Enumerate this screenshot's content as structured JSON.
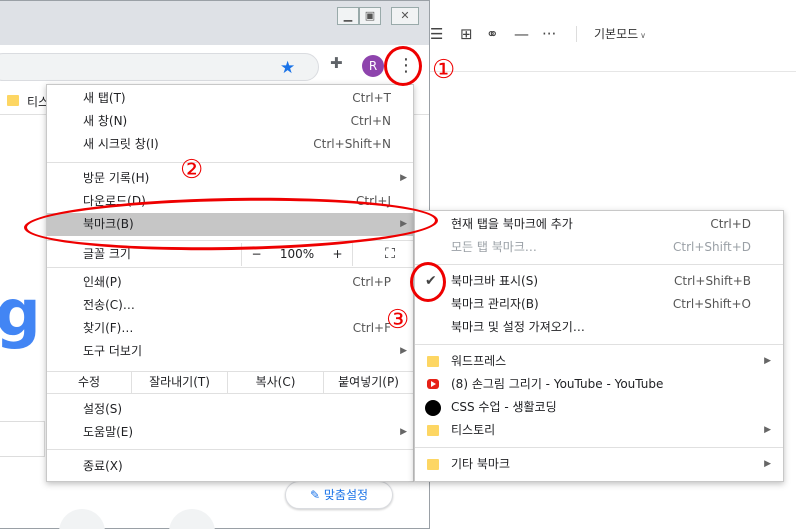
{
  "editor": {
    "mode_label": "기본모드",
    "icons": [
      "list-icon",
      "table-icon",
      "link-icon",
      "divider-icon",
      "more-icon"
    ]
  },
  "window": {
    "controls": [
      "minimize-icon",
      "restore-icon",
      "close-icon"
    ],
    "avatar_letter": "R",
    "bookmarks_bar": {
      "item": "티스"
    },
    "customize_button": "맞춤설정"
  },
  "menu": {
    "new_tab": {
      "label": "새 탭(T)",
      "shortcut": "Ctrl+T"
    },
    "new_window": {
      "label": "새 창(N)",
      "shortcut": "Ctrl+N"
    },
    "incognito": {
      "label": "새 시크릿 창(I)",
      "shortcut": "Ctrl+Shift+N"
    },
    "history": {
      "label": "방문 기록(H)"
    },
    "downloads": {
      "label": "다운로드(D)",
      "shortcut": "Ctrl+J"
    },
    "bookmarks": {
      "label": "북마크(B)"
    },
    "zoom": {
      "label": "글꼴 크기",
      "minus": "−",
      "value": "100%",
      "plus": "+"
    },
    "print": {
      "label": "인쇄(P)",
      "shortcut": "Ctrl+P"
    },
    "cast": {
      "label": "전송(C)…"
    },
    "find": {
      "label": "찾기(F)…",
      "shortcut": "Ctrl+F"
    },
    "more_tools": {
      "label": "도구 더보기"
    },
    "edit": {
      "label": "수정",
      "cut": "잘라내기(T)",
      "copy": "복사(C)",
      "paste": "붙여넣기(P)"
    },
    "settings": {
      "label": "설정(S)"
    },
    "help": {
      "label": "도움말(E)"
    },
    "exit": {
      "label": "종료(X)"
    }
  },
  "submenu": {
    "add_tab": {
      "label": "현재 탭을 북마크에 추가",
      "shortcut": "Ctrl+D"
    },
    "add_all": {
      "label": "모든 탭 북마크…",
      "shortcut": "Ctrl+Shift+D"
    },
    "show_bar": {
      "label": "북마크바 표시(S)",
      "shortcut": "Ctrl+Shift+B"
    },
    "manager": {
      "label": "북마크 관리자(B)",
      "shortcut": "Ctrl+Shift+O"
    },
    "import": {
      "label": "북마크 및 설정 가져오기…"
    },
    "items": [
      {
        "label": "워드프레스",
        "icon": "folder-icon"
      },
      {
        "label": "(8) 손그림 그리기 - YouTube - YouTube",
        "icon": "youtube-icon"
      },
      {
        "label": "CSS 수업 - 생활코딩",
        "icon": "dot-icon"
      },
      {
        "label": "티스토리",
        "icon": "folder-icon"
      }
    ],
    "other": {
      "label": "기타 북마크",
      "icon": "folder-icon"
    }
  },
  "annotations": {
    "step1": "①",
    "step2": "②",
    "step3": "③"
  },
  "colors": {
    "annotation": "#ee0000",
    "highlight": "#c6c6c6",
    "accent": "#1a73e8"
  }
}
